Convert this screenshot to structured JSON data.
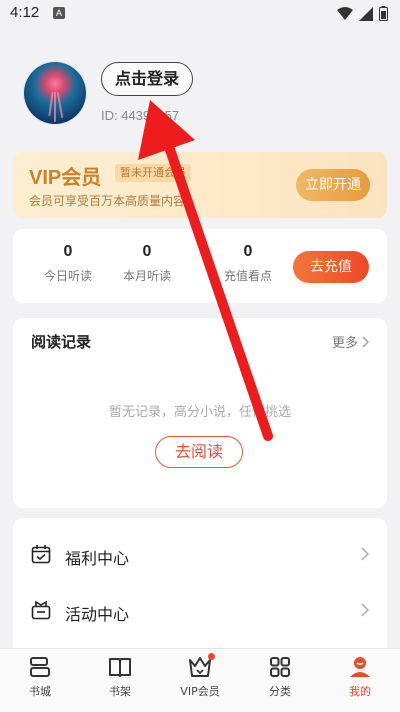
{
  "status_bar": {
    "time": "4:12",
    "notification_letter": "A"
  },
  "profile": {
    "login_label": "点击登录",
    "user_id": "ID: 44390957"
  },
  "vip": {
    "title": "VIP会员",
    "badge": "暂未开通会员",
    "subtitle": "会员可享受百万本高质量内容",
    "open_button": "立即开通",
    "accent_color": "#c9812a"
  },
  "stats": {
    "items": [
      {
        "value": "0",
        "label": "今日听读"
      },
      {
        "value": "0",
        "label": "本月听读"
      },
      {
        "value": "0",
        "label": "充值看点"
      }
    ],
    "recharge_button": "去充值"
  },
  "reading_history": {
    "title": "阅读记录",
    "more_label": "更多",
    "empty_text": "暂无记录，高分小说，任你挑选",
    "read_button": "去阅读"
  },
  "menu": {
    "items": [
      {
        "label": "福利中心",
        "icon": "calendar-check-icon"
      },
      {
        "label": "活动中心",
        "icon": "gift-box-icon"
      }
    ]
  },
  "tabbar": {
    "items": [
      {
        "label": "书城",
        "icon": "bookstore-icon"
      },
      {
        "label": "书架",
        "icon": "bookshelf-icon"
      },
      {
        "label": "VIP会员",
        "icon": "crown-icon"
      },
      {
        "label": "分类",
        "icon": "grid-icon"
      },
      {
        "label": "我的",
        "icon": "profile-icon"
      }
    ],
    "active_index": 4,
    "active_color": "#e94a2a"
  }
}
